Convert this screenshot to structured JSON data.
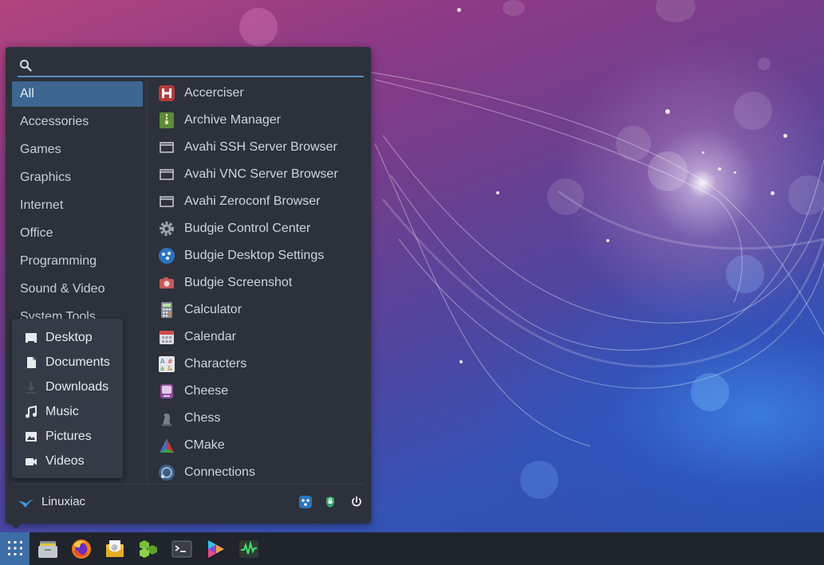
{
  "search": {
    "placeholder": "",
    "value": ""
  },
  "categories": [
    {
      "label": "All",
      "active": true
    },
    {
      "label": "Accessories",
      "active": false
    },
    {
      "label": "Games",
      "active": false
    },
    {
      "label": "Graphics",
      "active": false
    },
    {
      "label": "Internet",
      "active": false
    },
    {
      "label": "Office",
      "active": false
    },
    {
      "label": "Programming",
      "active": false
    },
    {
      "label": "Sound & Video",
      "active": false
    }
  ],
  "category_partial": "System Tools",
  "apps": [
    {
      "label": "Accerciser",
      "icon": "accerciser-icon"
    },
    {
      "label": "Archive Manager",
      "icon": "archive-manager-icon"
    },
    {
      "label": "Avahi SSH Server Browser",
      "icon": "network-window-icon"
    },
    {
      "label": "Avahi VNC Server Browser",
      "icon": "network-window-icon"
    },
    {
      "label": "Avahi Zeroconf Browser",
      "icon": "network-window-icon"
    },
    {
      "label": "Budgie Control Center",
      "icon": "gear-icon"
    },
    {
      "label": "Budgie Desktop Settings",
      "icon": "budgie-settings-icon"
    },
    {
      "label": "Budgie Screenshot",
      "icon": "camera-icon"
    },
    {
      "label": "Calculator",
      "icon": "calculator-icon"
    },
    {
      "label": "Calendar",
      "icon": "calendar-icon"
    },
    {
      "label": "Characters",
      "icon": "characters-icon"
    },
    {
      "label": "Cheese",
      "icon": "cheese-icon"
    },
    {
      "label": "Chess",
      "icon": "chess-icon"
    },
    {
      "label": "CMake",
      "icon": "cmake-icon"
    },
    {
      "label": "Connections",
      "icon": "connections-icon"
    }
  ],
  "places": [
    {
      "label": "Desktop",
      "icon": "desktop-icon"
    },
    {
      "label": "Documents",
      "icon": "document-icon"
    },
    {
      "label": "Downloads",
      "icon": "download-icon"
    },
    {
      "label": "Music",
      "icon": "music-icon"
    },
    {
      "label": "Pictures",
      "icon": "picture-icon"
    },
    {
      "label": "Videos",
      "icon": "video-icon"
    }
  ],
  "user": {
    "name": "Linuxiac"
  },
  "user_actions": [
    "budgie-settings-icon",
    "lock-icon",
    "power-icon"
  ],
  "taskbar": [
    {
      "name": "files",
      "icon": "files-icon"
    },
    {
      "name": "firefox",
      "icon": "firefox-icon"
    },
    {
      "name": "mail",
      "icon": "mail-icon"
    },
    {
      "name": "packages",
      "icon": "packages-icon"
    },
    {
      "name": "terminal",
      "icon": "terminal-icon"
    },
    {
      "name": "media-player",
      "icon": "media-player-icon"
    },
    {
      "name": "system-monitor",
      "icon": "system-monitor-icon"
    }
  ],
  "colors": {
    "menu_bg": "#2c313b",
    "active_category": "#3d6691",
    "accent": "#5c8fbd",
    "panel_bg": "#20242b",
    "launcher_bg": "#3d6da6"
  }
}
